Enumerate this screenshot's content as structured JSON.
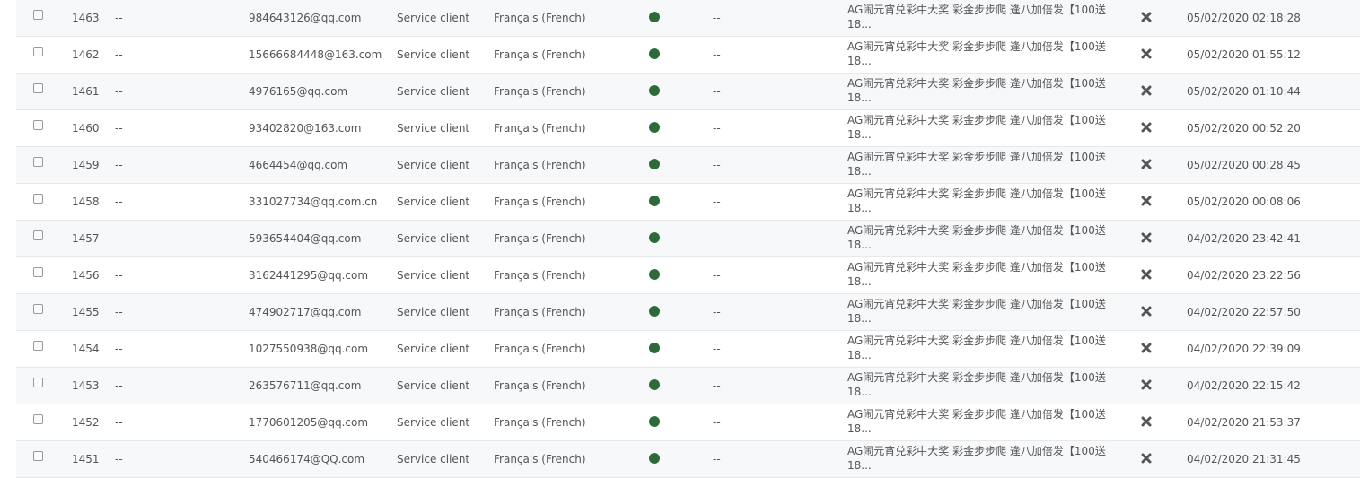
{
  "colors": {
    "status_dot": "#2d6a3a",
    "row_alt": "#f7f8fa",
    "border": "#e6e9ec",
    "text": "#555555",
    "x_icon": "#555555"
  },
  "rows": [
    {
      "id": "1463",
      "name": "--",
      "email": "984643126@qq.com",
      "service": "Service client",
      "language": "Français (French)",
      "col7": "--",
      "subject_line1": "AG闹元宵兑彩中大奖 彩金步步爬 逢八加倍发【100送",
      "subject_line2": "18...",
      "date": "05/02/2020 02:18:28"
    },
    {
      "id": "1462",
      "name": "--",
      "email": "15666684448@163.com",
      "service": "Service client",
      "language": "Français (French)",
      "col7": "--",
      "subject_line1": "AG闹元宵兑彩中大奖 彩金步步爬 逢八加倍发【100送",
      "subject_line2": "18...",
      "date": "05/02/2020 01:55:12"
    },
    {
      "id": "1461",
      "name": "--",
      "email": "4976165@qq.com",
      "service": "Service client",
      "language": "Français (French)",
      "col7": "--",
      "subject_line1": "AG闹元宵兑彩中大奖 彩金步步爬 逢八加倍发【100送",
      "subject_line2": "18...",
      "date": "05/02/2020 01:10:44"
    },
    {
      "id": "1460",
      "name": "--",
      "email": "93402820@163.com",
      "service": "Service client",
      "language": "Français (French)",
      "col7": "--",
      "subject_line1": "AG闹元宵兑彩中大奖 彩金步步爬 逢八加倍发【100送",
      "subject_line2": "18...",
      "date": "05/02/2020 00:52:20"
    },
    {
      "id": "1459",
      "name": "--",
      "email": "4664454@qq.com",
      "service": "Service client",
      "language": "Français (French)",
      "col7": "--",
      "subject_line1": "AG闹元宵兑彩中大奖 彩金步步爬 逢八加倍发【100送",
      "subject_line2": "18...",
      "date": "05/02/2020 00:28:45"
    },
    {
      "id": "1458",
      "name": "--",
      "email": "331027734@qq.com.cn",
      "service": "Service client",
      "language": "Français (French)",
      "col7": "--",
      "subject_line1": "AG闹元宵兑彩中大奖 彩金步步爬 逢八加倍发【100送",
      "subject_line2": "18...",
      "date": "05/02/2020 00:08:06"
    },
    {
      "id": "1457",
      "name": "--",
      "email": "593654404@qq.com",
      "service": "Service client",
      "language": "Français (French)",
      "col7": "--",
      "subject_line1": "AG闹元宵兑彩中大奖 彩金步步爬 逢八加倍发【100送",
      "subject_line2": "18...",
      "date": "04/02/2020 23:42:41"
    },
    {
      "id": "1456",
      "name": "--",
      "email": "3162441295@qq.com",
      "service": "Service client",
      "language": "Français (French)",
      "col7": "--",
      "subject_line1": "AG闹元宵兑彩中大奖 彩金步步爬 逢八加倍发【100送",
      "subject_line2": "18...",
      "date": "04/02/2020 23:22:56"
    },
    {
      "id": "1455",
      "name": "--",
      "email": "474902717@qq.com",
      "service": "Service client",
      "language": "Français (French)",
      "col7": "--",
      "subject_line1": "AG闹元宵兑彩中大奖 彩金步步爬 逢八加倍发【100送",
      "subject_line2": "18...",
      "date": "04/02/2020 22:57:50"
    },
    {
      "id": "1454",
      "name": "--",
      "email": "1027550938@qq.com",
      "service": "Service client",
      "language": "Français (French)",
      "col7": "--",
      "subject_line1": "AG闹元宵兑彩中大奖 彩金步步爬 逢八加倍发【100送",
      "subject_line2": "18...",
      "date": "04/02/2020 22:39:09"
    },
    {
      "id": "1453",
      "name": "--",
      "email": "263576711@qq.com",
      "service": "Service client",
      "language": "Français (French)",
      "col7": "--",
      "subject_line1": "AG闹元宵兑彩中大奖 彩金步步爬 逢八加倍发【100送",
      "subject_line2": "18...",
      "date": "04/02/2020 22:15:42"
    },
    {
      "id": "1452",
      "name": "--",
      "email": "1770601205@qq.com",
      "service": "Service client",
      "language": "Français (French)",
      "col7": "--",
      "subject_line1": "AG闹元宵兑彩中大奖 彩金步步爬 逢八加倍发【100送",
      "subject_line2": "18...",
      "date": "04/02/2020 21:53:37"
    },
    {
      "id": "1451",
      "name": "--",
      "email": "540466174@QQ.com",
      "service": "Service client",
      "language": "Français (French)",
      "col7": "--",
      "subject_line1": "AG闹元宵兑彩中大奖 彩金步步爬 逢八加倍发【100送",
      "subject_line2": "18...",
      "date": "04/02/2020 21:31:45"
    }
  ]
}
